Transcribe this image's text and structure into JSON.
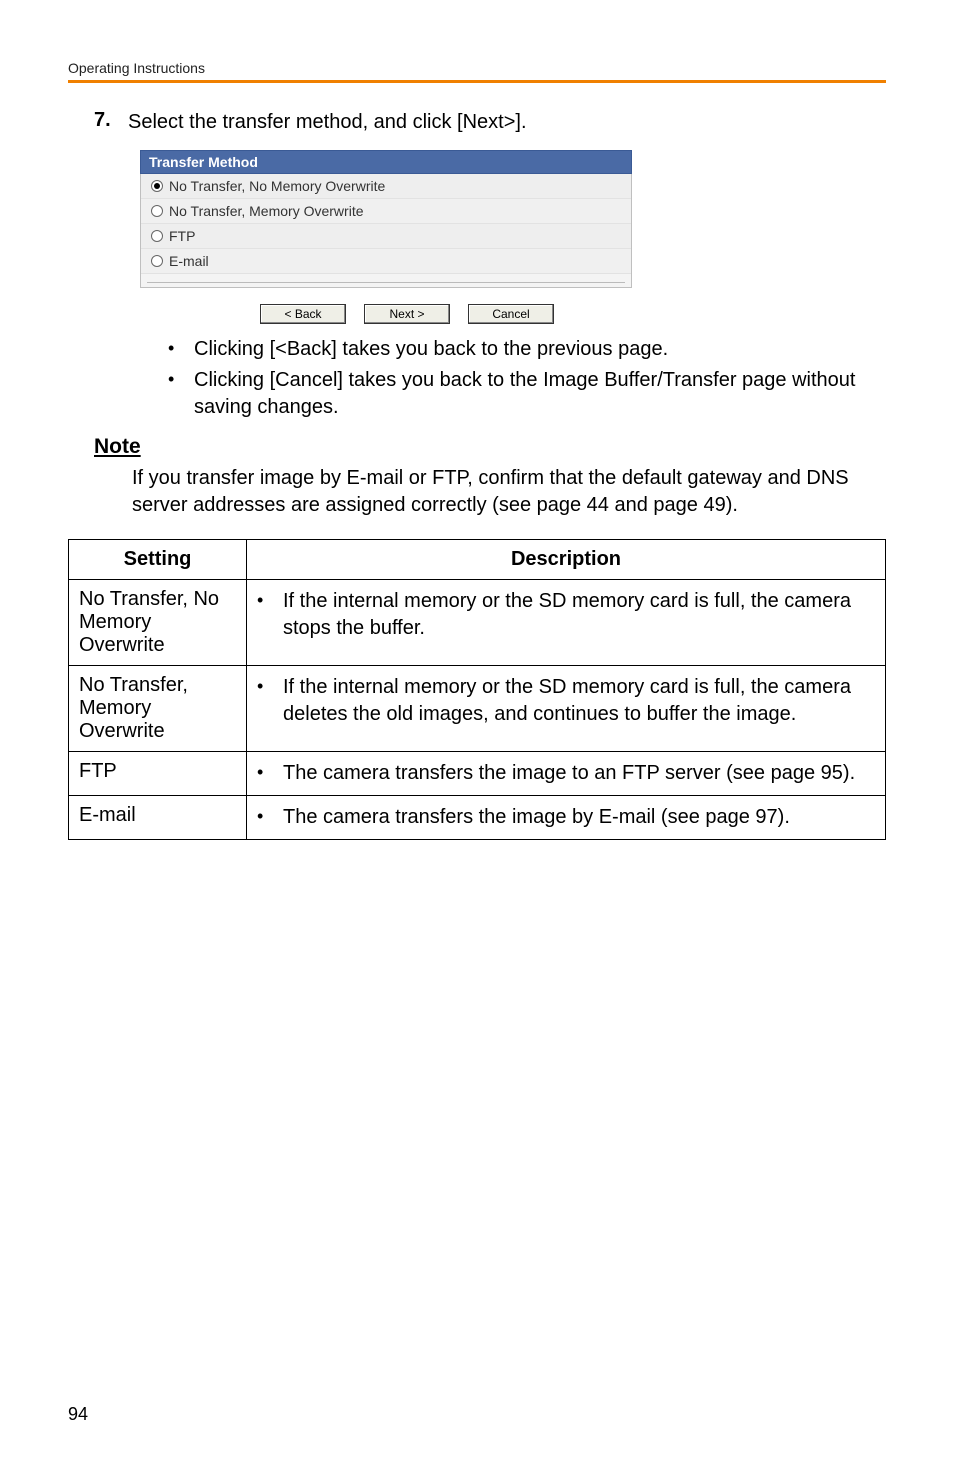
{
  "header": "Operating Instructions",
  "step": {
    "number": "7.",
    "text": "Select the transfer method, and click [Next>]."
  },
  "dialog": {
    "title": "Transfer Method",
    "options": [
      {
        "label": "No Transfer, No Memory Overwrite",
        "selected": true
      },
      {
        "label": "No Transfer, Memory Overwrite",
        "selected": false
      },
      {
        "label": "FTP",
        "selected": false
      },
      {
        "label": "E-mail",
        "selected": false
      }
    ],
    "buttons": {
      "back": "< Back",
      "next": "Next >",
      "cancel": "Cancel"
    }
  },
  "bullets": [
    "Clicking [<Back] takes you back to the previous page.",
    "Clicking [Cancel] takes you back to the Image Buffer/Transfer page without saving changes."
  ],
  "note": {
    "heading": "Note",
    "body": "If you transfer image by E-mail or FTP, confirm that the default gateway and DNS server addresses are assigned correctly (see page 44 and page 49)."
  },
  "table": {
    "headers": {
      "setting": "Setting",
      "description": "Description"
    },
    "rows": [
      {
        "setting": "No Transfer, No Memory Overwrite",
        "description": "If the internal memory or the SD memory card is full, the camera stops the buffer."
      },
      {
        "setting": "No Transfer, Memory Overwrite",
        "description": "If the internal memory or the SD memory card is full, the camera deletes the old images, and continues to buffer the image."
      },
      {
        "setting": "FTP",
        "description": "The camera transfers the image to an FTP server (see page 95)."
      },
      {
        "setting": "E-mail",
        "description": "The camera transfers the image by E-mail (see page 97)."
      }
    ]
  },
  "pageNumber": "94"
}
